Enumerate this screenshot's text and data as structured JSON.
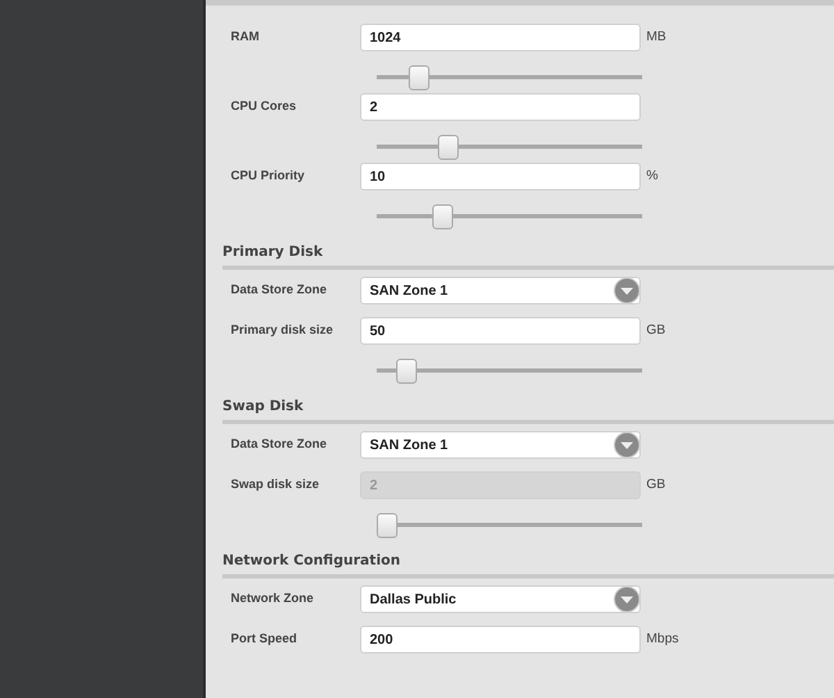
{
  "sections": [
    {
      "rows": [
        {
          "kind": "input",
          "label": "RAM",
          "value": "1024",
          "unit": "MB",
          "disabled": false,
          "slider": {
            "level": 0.13
          }
        },
        {
          "kind": "input",
          "label": "CPU Cores",
          "value": "2",
          "disabled": false,
          "slider": {
            "level": 0.25
          }
        },
        {
          "kind": "input",
          "label": "CPU Priority",
          "value": "10",
          "unit": "%",
          "disabled": false,
          "slider": {
            "level": 0.23
          }
        }
      ]
    },
    {
      "title": "Primary Disk",
      "rows": [
        {
          "kind": "select",
          "label": "Data Store Zone",
          "value": "SAN Zone 1"
        },
        {
          "kind": "input",
          "label": "Primary disk size",
          "value": "50",
          "unit": "GB",
          "disabled": false,
          "slider": {
            "level": 0.08
          }
        }
      ]
    },
    {
      "title": "Swap Disk",
      "rows": [
        {
          "kind": "select",
          "label": "Data Store Zone",
          "value": "SAN Zone 1"
        },
        {
          "kind": "input",
          "label": "Swap disk size",
          "value": "2",
          "unit": "GB",
          "disabled": true,
          "slider": {
            "level": 0
          }
        }
      ]
    },
    {
      "title": "Network Configuration",
      "rows": [
        {
          "kind": "select",
          "label": "Network Zone",
          "value": "Dallas Public"
        },
        {
          "kind": "input",
          "label": "Port Speed",
          "value": "200",
          "unit": "Mbps",
          "disabled": false
        }
      ]
    }
  ]
}
